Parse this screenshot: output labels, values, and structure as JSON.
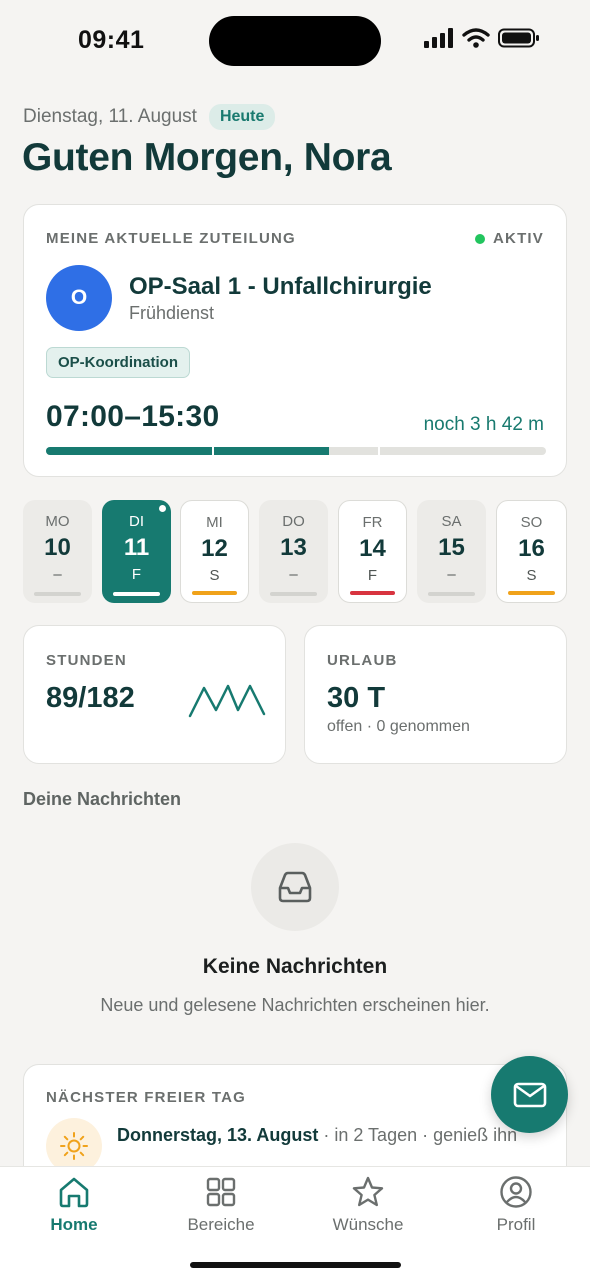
{
  "status_bar": {
    "time": "09:41"
  },
  "header": {
    "date": "Dienstag, 11. August",
    "today_badge": "Heute",
    "greeting": "Guten Morgen, Nora"
  },
  "assignment": {
    "heading": "MEINE AKTUELLE ZUTEILUNG",
    "status": "AKTIV",
    "avatar_letter": "O",
    "room": "OP-Saal 1 - Unfallchirurgie",
    "shift": "Frühdienst",
    "role": "OP-Koordination",
    "time_range": "07:00–15:30",
    "remaining": "noch 3 h 42 m",
    "progress": 0.565
  },
  "week": [
    {
      "abbr": "MO",
      "num": "10",
      "code": "–",
      "state": "muted",
      "bar_color": "#d3d3cf"
    },
    {
      "abbr": "DI",
      "num": "11",
      "code": "F",
      "state": "selected",
      "bar_color": "#ffffff"
    },
    {
      "abbr": "MI",
      "num": "12",
      "code": "S",
      "state": "normal",
      "bar_color": "#f0a21a"
    },
    {
      "abbr": "DO",
      "num": "13",
      "code": "–",
      "state": "muted",
      "bar_color": "#d3d3cf"
    },
    {
      "abbr": "FR",
      "num": "14",
      "code": "F",
      "state": "normal",
      "bar_color": "#d8343f"
    },
    {
      "abbr": "SA",
      "num": "15",
      "code": "–",
      "state": "muted",
      "bar_color": "#d3d3cf"
    },
    {
      "abbr": "SO",
      "num": "16",
      "code": "S",
      "state": "normal",
      "bar_color": "#f0a21a"
    }
  ],
  "hours": {
    "label": "STUNDEN",
    "value": "89/182"
  },
  "vacation": {
    "label": "URLAUB",
    "value": "30 T",
    "sub": "offen · 0 genommen"
  },
  "messages": {
    "section_title": "Deine Nachrichten",
    "icon": "inbox-icon",
    "empty_title": "Keine Nachrichten",
    "empty_sub": "Neue und gelesene Nachrichten erscheinen hier."
  },
  "next_free": {
    "heading": "NÄCHSTER FREIER TAG",
    "icon": "sun-icon",
    "date": "Donnerstag, 13. August",
    "rest": " · in 2 Tagen · genieß ihn"
  },
  "fab": {
    "icon": "mail-icon"
  },
  "tabs": [
    {
      "label": "Home",
      "icon": "home-icon",
      "active": true
    },
    {
      "label": "Bereiche",
      "icon": "grid-icon",
      "active": false
    },
    {
      "label": "Wünsche",
      "icon": "star-icon",
      "active": false
    },
    {
      "label": "Profil",
      "icon": "profile-icon",
      "active": false
    }
  ],
  "colors": {
    "accent": "#177a70",
    "active_dot": "#22c55e",
    "avatar": "#2f6fe6",
    "background": "#f5f4f2"
  }
}
